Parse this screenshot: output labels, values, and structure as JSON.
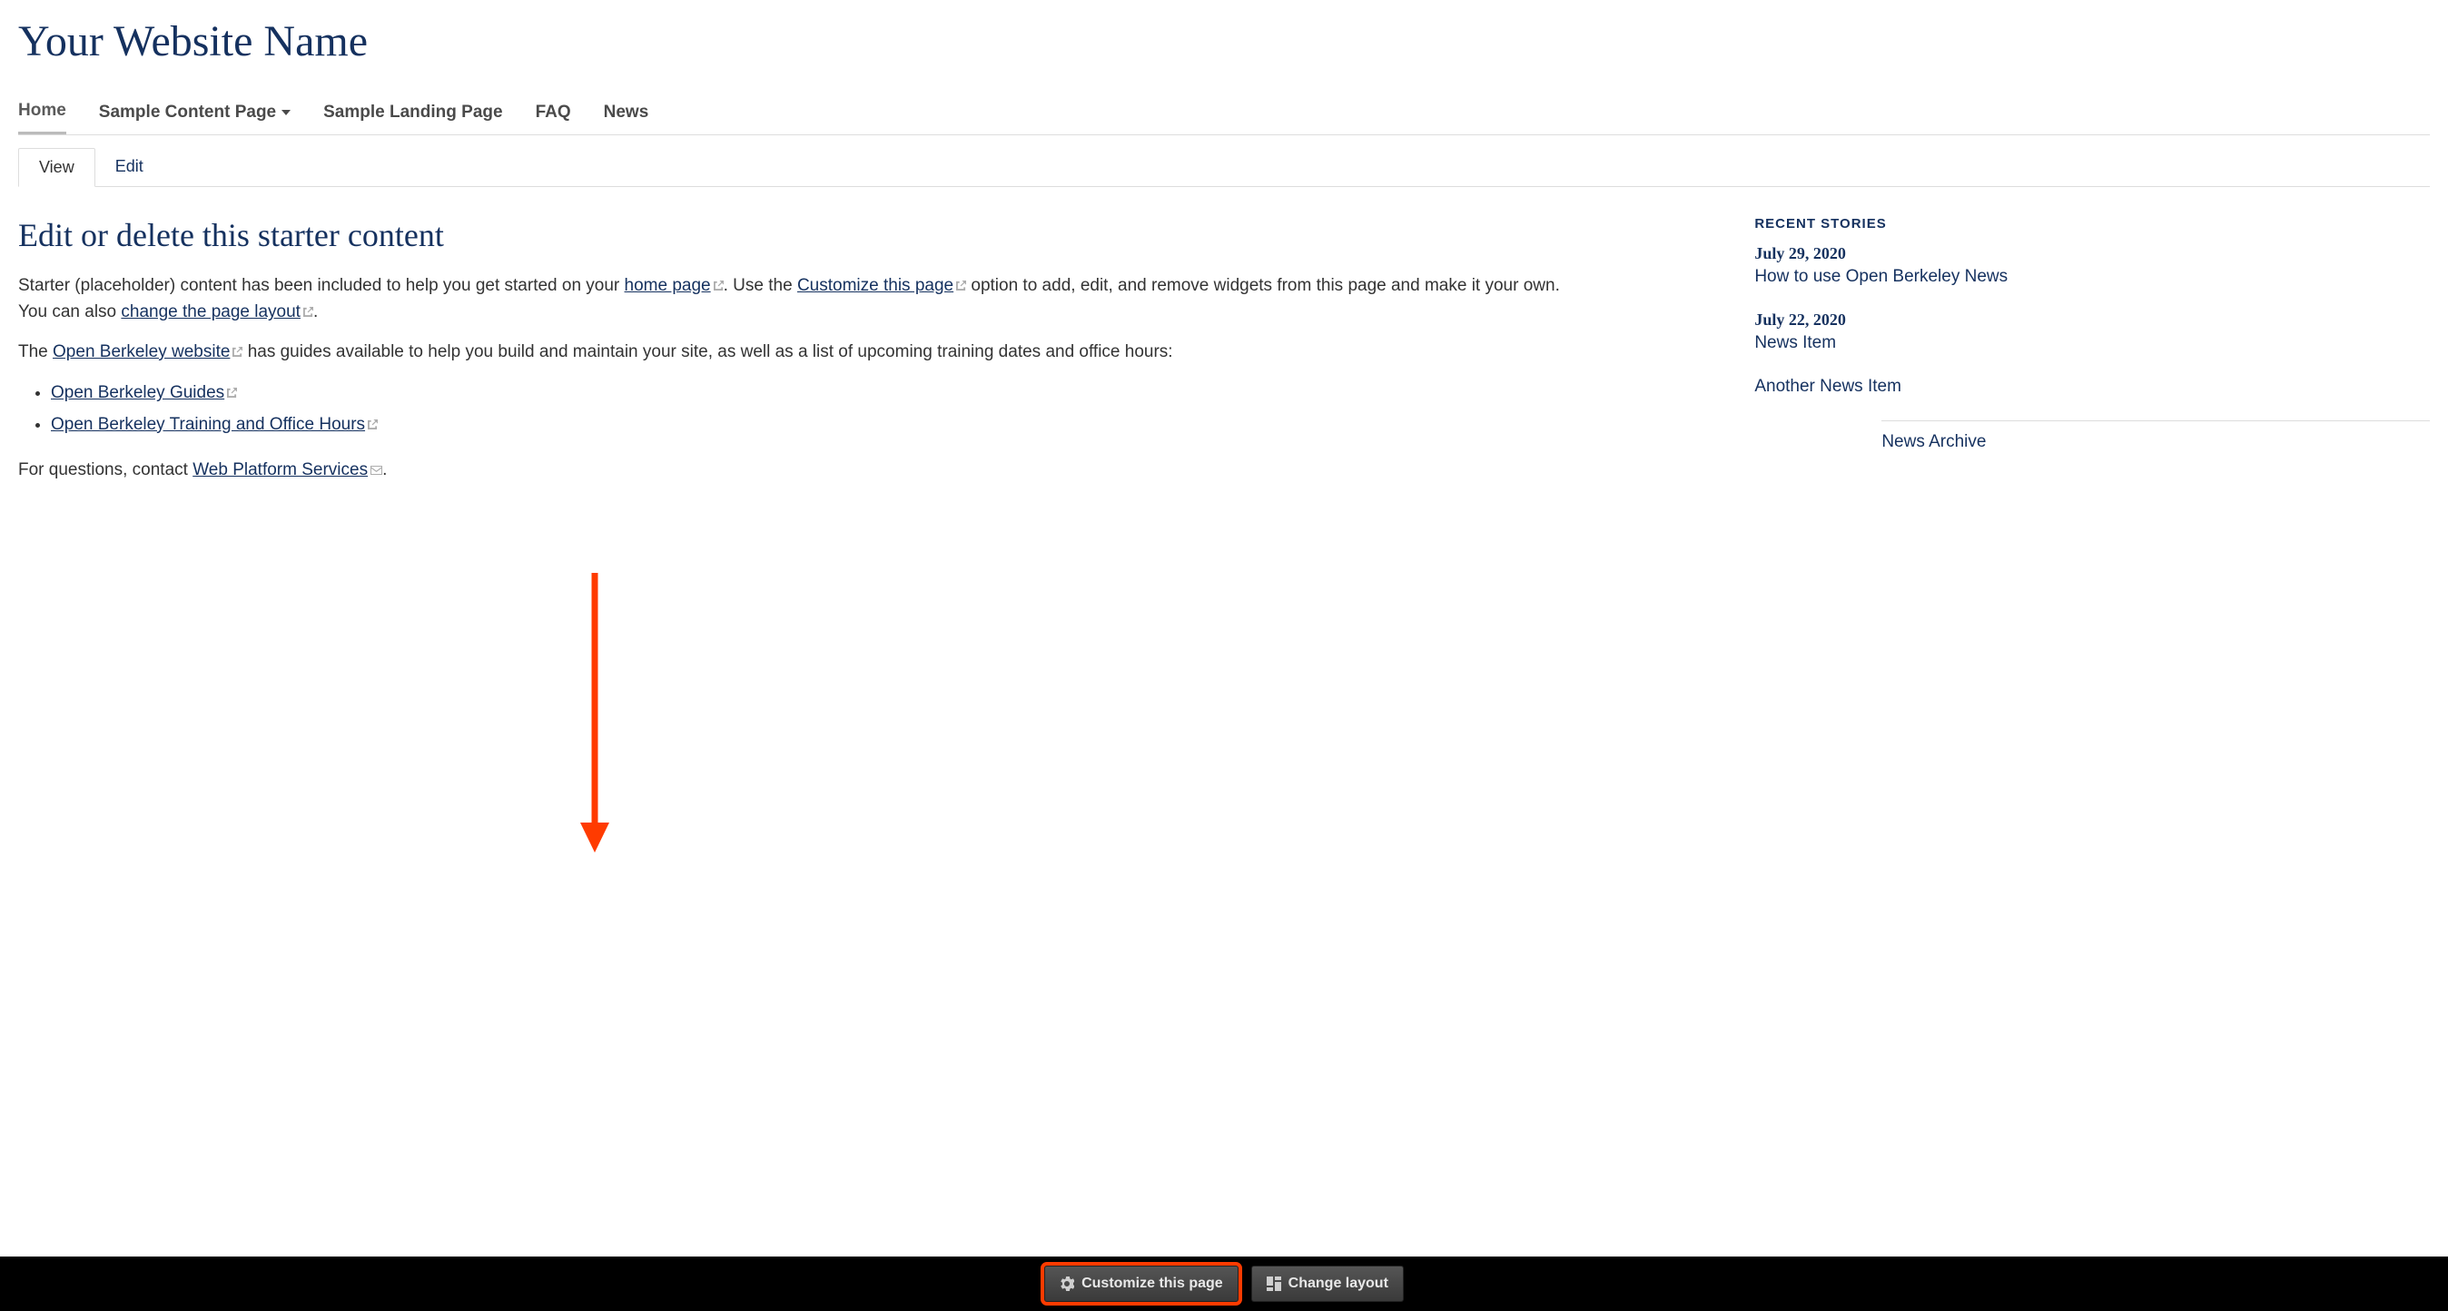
{
  "site": {
    "title": "Your Website Name"
  },
  "nav": {
    "items": [
      {
        "label": "Home",
        "active": true,
        "has_dropdown": false
      },
      {
        "label": "Sample Content Page",
        "active": false,
        "has_dropdown": true
      },
      {
        "label": "Sample Landing Page",
        "active": false,
        "has_dropdown": false
      },
      {
        "label": "FAQ",
        "active": false,
        "has_dropdown": false
      },
      {
        "label": "News",
        "active": false,
        "has_dropdown": false
      }
    ]
  },
  "tabs": {
    "view": "View",
    "edit": "Edit",
    "active": "view"
  },
  "main": {
    "heading": "Edit or delete this starter content",
    "para1": {
      "t1": "Starter (placeholder) content has been included to help you get started on your ",
      "link_home": "home page",
      "t2": ". Use the ",
      "link_customize": "Customize this page",
      "t3": " option to add, edit, and remove widgets from this page and make it your own. You can also ",
      "link_change_layout": "change the page layout",
      "t4": "."
    },
    "para2": {
      "t1": "The ",
      "link_obw": "Open Berkeley website",
      "t2": " has guides available to help you build and maintain your site, as well as a list of upcoming training dates and office hours:"
    },
    "bullets": {
      "0": "Open Berkeley Guides",
      "1": "Open Berkeley Training and Office Hours"
    },
    "para3": {
      "t1": "For questions, contact ",
      "link_wps": "Web Platform Services",
      "t2": "."
    }
  },
  "sidebar": {
    "heading": "Recent Stories",
    "stories": [
      {
        "date": "July 29, 2020",
        "title": "How to use Open Berkeley News"
      },
      {
        "date": "July 22, 2020",
        "title": "News Item"
      },
      {
        "date": "",
        "title": "Another News Item"
      }
    ],
    "archive": "News Archive"
  },
  "actionbar": {
    "customize": "Customize this page",
    "change_layout": "Change layout"
  }
}
